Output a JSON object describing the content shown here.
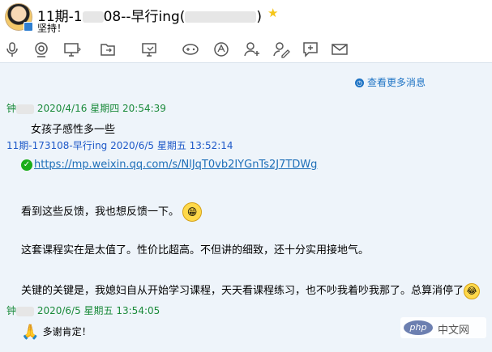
{
  "header": {
    "title_prefix": "11期-1",
    "title_mid": "08--早行ing(",
    "title_suffix": ")",
    "signature": "坚持！"
  },
  "toolbar": {
    "icons": [
      "microphone-icon",
      "camera-icon",
      "screen-share-icon",
      "file-transfer-icon",
      "remote-desktop-icon",
      "game-icon",
      "app-icon",
      "add-member-icon",
      "chat-plus-icon",
      "mail-icon"
    ]
  },
  "history": {
    "more_label": "查看更多消息"
  },
  "messages": [
    {
      "sender": "钟",
      "timestamp": "2020/4/16 星期四 20:54:39",
      "text": "女孩子感性多一些"
    },
    {
      "sender": "11期-173108-早行ing",
      "timestamp": "2020/6/5 星期五 13:52:14",
      "link": "https://mp.weixin.qq.com/s/NlJqT0vb2IYGnTs2J7TDWg",
      "p1": "看到这些反馈，我也想反馈一下。",
      "p2": "这套课程实在是太值了。性价比超高。不但讲的细致，还十分实用接地气。",
      "p3": "关键的关键是，我媳妇自从开始学习课程，天天看课程练习，也不吵我着吵我那了。总算消停了"
    },
    {
      "sender": "钟",
      "timestamp": "2020/6/5 星期五 13:54:05",
      "text": "多谢肯定！"
    }
  ],
  "watermark": {
    "logo": "php",
    "text": "中文网"
  },
  "colors": {
    "own_name": "#1e59c8",
    "other_name": "#1a8a3a",
    "link": "#1e6fb8",
    "background": "#eef4fa"
  }
}
